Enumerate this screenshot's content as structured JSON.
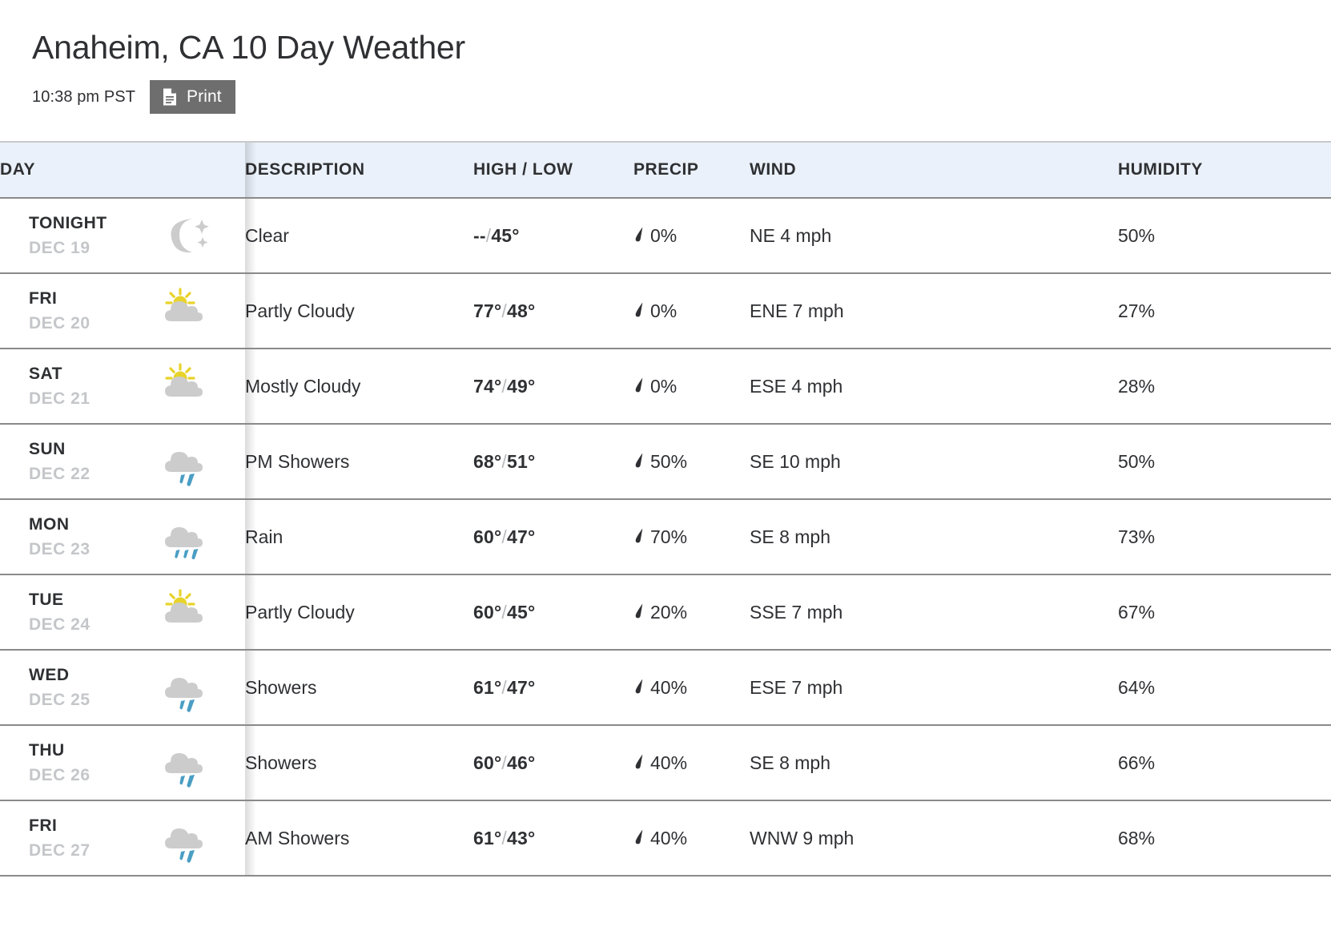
{
  "header": {
    "title": "Anaheim, CA 10 Day Weather",
    "timestamp": "10:38 pm PST",
    "print_label": "Print",
    "print_icon": "document-icon"
  },
  "colors": {
    "table_header_bg": "#eaf1fa",
    "row_border": "#8a8a8a",
    "text": "#2f3033",
    "muted_text": "#c4c6c9",
    "print_button_bg": "#6e6e6e",
    "cloud_gray": "#cccccc",
    "sun_yellow": "#e8d32a",
    "rain_blue": "#4a9ec4",
    "precip_drop": "#2f3033"
  },
  "table": {
    "columns": [
      {
        "key": "day",
        "label": "DAY"
      },
      {
        "key": "description",
        "label": "DESCRIPTION"
      },
      {
        "key": "temp",
        "label": "HIGH / LOW"
      },
      {
        "key": "precip",
        "label": "PRECIP"
      },
      {
        "key": "wind",
        "label": "WIND"
      },
      {
        "key": "humidity",
        "label": "HUMIDITY"
      }
    ],
    "rows": [
      {
        "day_name": "TONIGHT",
        "day_date": "DEC 19",
        "icon": "moon-stars-icon",
        "description": "Clear",
        "high": "--",
        "low": "45",
        "temp": "--/45°",
        "precip": "0%",
        "wind": "NE 4 mph",
        "humidity": "50%"
      },
      {
        "day_name": "FRI",
        "day_date": "DEC 20",
        "icon": "sun-behind-cloud-icon",
        "description": "Partly Cloudy",
        "high": "77",
        "low": "48",
        "temp": "77°/48°",
        "precip": "0%",
        "wind": "ENE 7 mph",
        "humidity": "27%"
      },
      {
        "day_name": "SAT",
        "day_date": "DEC 21",
        "icon": "sun-behind-cloud-icon",
        "description": "Mostly Cloudy",
        "high": "74",
        "low": "49",
        "temp": "74°/49°",
        "precip": "0%",
        "wind": "ESE 4 mph",
        "humidity": "28%"
      },
      {
        "day_name": "SUN",
        "day_date": "DEC 22",
        "icon": "rain-cloud-icon",
        "description": "PM Showers",
        "high": "68",
        "low": "51",
        "temp": "68°/51°",
        "precip": "50%",
        "wind": "SE 10 mph",
        "humidity": "50%"
      },
      {
        "day_name": "MON",
        "day_date": "DEC 23",
        "icon": "heavy-rain-cloud-icon",
        "description": "Rain",
        "high": "60",
        "low": "47",
        "temp": "60°/47°",
        "precip": "70%",
        "wind": "SE 8 mph",
        "humidity": "73%"
      },
      {
        "day_name": "TUE",
        "day_date": "DEC 24",
        "icon": "sun-behind-cloud-icon",
        "description": "Partly Cloudy",
        "high": "60",
        "low": "45",
        "temp": "60°/45°",
        "precip": "20%",
        "wind": "SSE 7 mph",
        "humidity": "67%"
      },
      {
        "day_name": "WED",
        "day_date": "DEC 25",
        "icon": "rain-cloud-icon",
        "description": "Showers",
        "high": "61",
        "low": "47",
        "temp": "61°/47°",
        "precip": "40%",
        "wind": "ESE 7 mph",
        "humidity": "64%"
      },
      {
        "day_name": "THU",
        "day_date": "DEC 26",
        "icon": "rain-cloud-icon",
        "description": "Showers",
        "high": "60",
        "low": "46",
        "temp": "60°/46°",
        "precip": "40%",
        "wind": "SE 8 mph",
        "humidity": "66%"
      },
      {
        "day_name": "FRI",
        "day_date": "DEC 27",
        "icon": "rain-cloud-icon",
        "description": "AM Showers",
        "high": "61",
        "low": "43",
        "temp": "61°/43°",
        "precip": "40%",
        "wind": "WNW 9 mph",
        "humidity": "68%"
      }
    ]
  }
}
